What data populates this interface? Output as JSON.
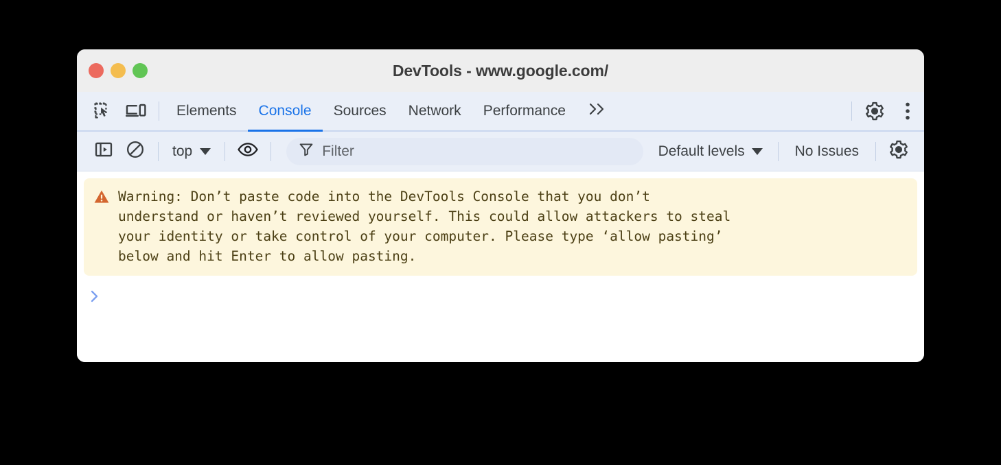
{
  "window": {
    "title": "DevTools - www.google.com/",
    "traffic_lights": [
      {
        "name": "close",
        "color": "#ec6a5e"
      },
      {
        "name": "minimize",
        "color": "#f4bd4f"
      },
      {
        "name": "maximize",
        "color": "#61c555"
      }
    ]
  },
  "tabbar": {
    "inspect_icon": "inspect-element-icon",
    "device_icon": "device-toolbar-icon",
    "tabs": [
      {
        "label": "Elements",
        "active": false
      },
      {
        "label": "Console",
        "active": true
      },
      {
        "label": "Sources",
        "active": false
      },
      {
        "label": "Network",
        "active": false
      },
      {
        "label": "Performance",
        "active": false
      }
    ],
    "overflow_label": "»",
    "settings_icon": "gear-icon",
    "more_icon": "more-vertical-icon"
  },
  "console_toolbar": {
    "sidebar_toggle_icon": "console-sidebar-icon",
    "clear_icon": "clear-console-icon",
    "context_label": "top",
    "eye_icon": "live-expression-eye-icon",
    "filter_placeholder": "Filter",
    "filter_value": "",
    "filter_icon": "filter-funnel-icon",
    "levels_label": "Default levels",
    "issues_label": "No Issues",
    "settings_icon": "gear-icon"
  },
  "console": {
    "warning": {
      "icon": "warning-triangle-icon",
      "accent_color": "#d4662f",
      "background_color": "#fdf6dd",
      "text": "Warning: Don’t paste code into the DevTools Console that you don’t\nunderstand or haven’t reviewed yourself. This could allow attackers to steal\nyour identity or take control of your computer. Please type ‘allow pasting’\nbelow and hit Enter to allow pasting."
    },
    "prompt": {
      "caret_icon": "prompt-chevron-right-icon",
      "caret_color": "#7b9ff0",
      "input_value": ""
    }
  },
  "theme": {
    "accent_blue": "#1a73e8",
    "toolbar_bg": "#eaeff8",
    "titlebar_bg": "#eeeeee",
    "page_bg": "#000000"
  }
}
